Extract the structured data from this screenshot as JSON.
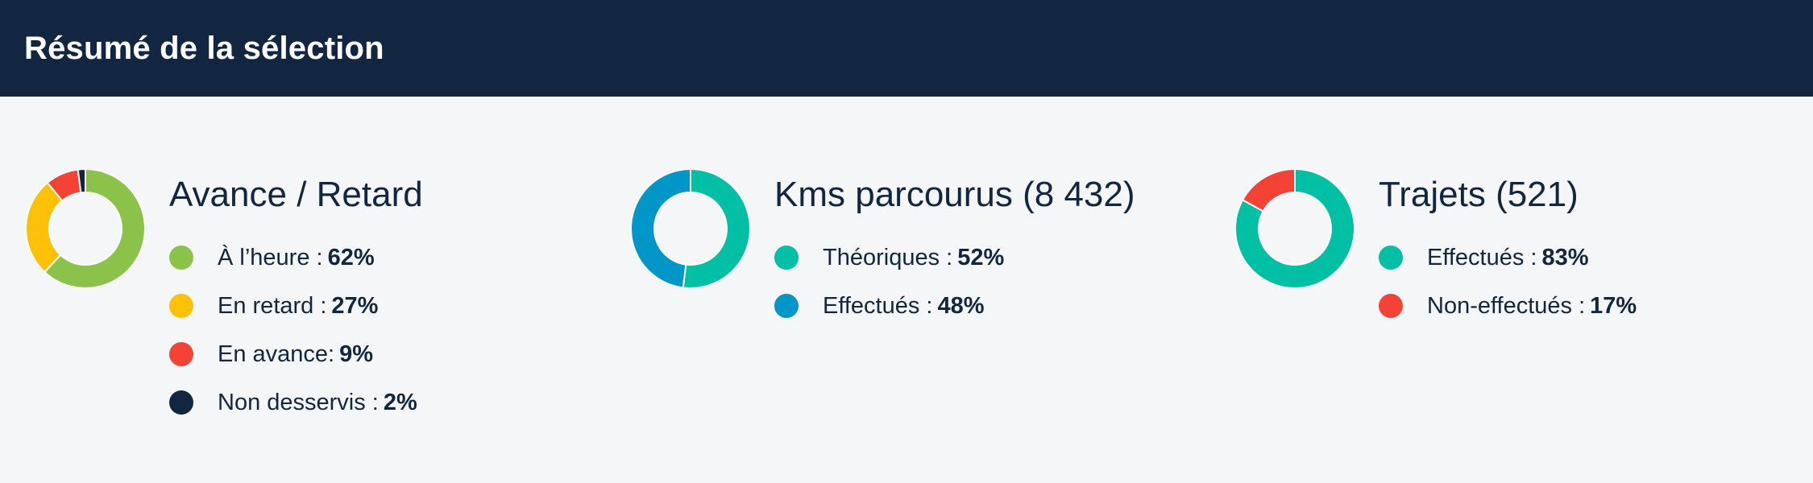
{
  "header": {
    "title": "Résumé de la sélection"
  },
  "chart_data": [
    {
      "type": "pie",
      "title": "Avance / Retard",
      "series": [
        {
          "name": "À l’heure :",
          "value": 62,
          "label": "62%",
          "color": "#8bc34a"
        },
        {
          "name": "En retard :",
          "value": 27,
          "label": "27%",
          "color": "#ffc107"
        },
        {
          "name": "En avance:",
          "value": 9,
          "label": "9%",
          "color": "#f44336"
        },
        {
          "name": "Non desservis :",
          "value": 2,
          "label": "2%",
          "color": "#13263f"
        }
      ]
    },
    {
      "type": "pie",
      "title": "Kms parcourus (8 432)",
      "series": [
        {
          "name": "Théoriques :",
          "value": 52,
          "label": "52%",
          "color": "#00bfa5"
        },
        {
          "name": "Effectués :",
          "value": 48,
          "label": "48%",
          "color": "#0096c7"
        }
      ]
    },
    {
      "type": "pie",
      "title": "Trajets (521)",
      "series": [
        {
          "name": "Effectués :",
          "value": 83,
          "label": "83%",
          "color": "#00bfa5"
        },
        {
          "name": "Non-effectués :",
          "value": 17,
          "label": "17%",
          "color": "#f44336"
        }
      ]
    }
  ]
}
